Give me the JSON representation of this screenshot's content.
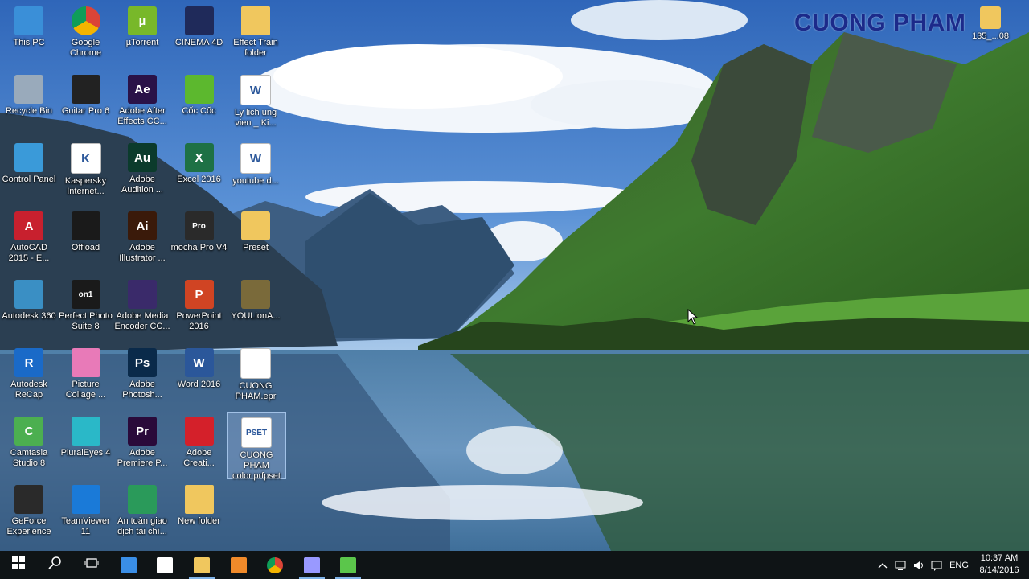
{
  "watermark": "CUONG PHAM",
  "desktop_icons": [
    {
      "label": "This PC",
      "icon": "monitor-icon",
      "color": "#3a8fd8",
      "glyph": "",
      "col": 0,
      "row": 0
    },
    {
      "label": "Google Chrome",
      "icon": "chrome-icon",
      "color": "#db4437",
      "glyph": "",
      "col": 1,
      "row": 0
    },
    {
      "label": "µTorrent",
      "icon": "utorrent-icon",
      "color": "#78b82a",
      "glyph": "µ",
      "col": 2,
      "row": 0
    },
    {
      "label": "CINEMA 4D",
      "icon": "cinema4d-icon",
      "color": "#1f2a5a",
      "glyph": "",
      "col": 3,
      "row": 0
    },
    {
      "label": "Effect Train folder",
      "icon": "folder-icon",
      "color": "#f0c75e",
      "glyph": "",
      "col": 4,
      "row": 0
    },
    {
      "label": "Recycle Bin",
      "icon": "recycle-bin-icon",
      "color": "#9ab",
      "glyph": "",
      "col": 0,
      "row": 1
    },
    {
      "label": "Guitar Pro 6",
      "icon": "guitar-pro-icon",
      "color": "#222",
      "glyph": "",
      "col": 1,
      "row": 1
    },
    {
      "label": "Adobe After Effects CC...",
      "icon": "after-effects-icon",
      "color": "#2a1248",
      "glyph": "Ae",
      "col": 2,
      "row": 1
    },
    {
      "label": "Cốc Cốc",
      "icon": "coccoc-icon",
      "color": "#5cb82e",
      "glyph": "",
      "col": 3,
      "row": 1
    },
    {
      "label": "Ly lich ung vien _ Ki...",
      "icon": "word-doc-icon",
      "color": "#ffffff",
      "glyph": "W",
      "col": 4,
      "row": 1
    },
    {
      "label": "Control Panel",
      "icon": "control-panel-icon",
      "color": "#3a9ad9",
      "glyph": "",
      "col": 0,
      "row": 2
    },
    {
      "label": "Kaspersky Internet...",
      "icon": "kaspersky-icon",
      "color": "#ffffff",
      "glyph": "K",
      "col": 1,
      "row": 2
    },
    {
      "label": "Adobe Audition ...",
      "icon": "audition-icon",
      "color": "#0b3b2c",
      "glyph": "Au",
      "col": 2,
      "row": 2
    },
    {
      "label": "Excel 2016",
      "icon": "excel-icon",
      "color": "#1e7145",
      "glyph": "X",
      "col": 3,
      "row": 2
    },
    {
      "label": "youtube.d...",
      "icon": "word-doc-icon",
      "color": "#ffffff",
      "glyph": "W",
      "col": 4,
      "row": 2
    },
    {
      "label": "AutoCAD 2015 - E...",
      "icon": "autocad-icon",
      "color": "#c8202e",
      "glyph": "A",
      "col": 0,
      "row": 3
    },
    {
      "label": "Offload",
      "icon": "offload-icon",
      "color": "#1a1a1a",
      "glyph": "",
      "col": 1,
      "row": 3
    },
    {
      "label": "Adobe Illustrator ...",
      "icon": "illustrator-icon",
      "color": "#3a1a0a",
      "glyph": "Ai",
      "col": 2,
      "row": 3
    },
    {
      "label": "mocha Pro V4",
      "icon": "mocha-icon",
      "color": "#2a2a2a",
      "glyph": "Pro",
      "col": 3,
      "row": 3
    },
    {
      "label": "Preset",
      "icon": "premiere-preset-icon",
      "color": "#f0c75e",
      "glyph": "",
      "col": 4,
      "row": 3
    },
    {
      "label": "Autodesk 360",
      "icon": "autodesk360-icon",
      "color": "#3a8fc4",
      "glyph": "",
      "col": 0,
      "row": 4
    },
    {
      "label": "Perfect Photo Suite 8",
      "icon": "perfect-photo-icon",
      "color": "#1a1a1a",
      "glyph": "on1",
      "col": 1,
      "row": 4
    },
    {
      "label": "Adobe Media Encoder CC...",
      "icon": "media-encoder-icon",
      "color": "#3a2a6a",
      "glyph": "",
      "col": 2,
      "row": 4
    },
    {
      "label": "PowerPoint 2016",
      "icon": "powerpoint-icon",
      "color": "#d04423",
      "glyph": "P",
      "col": 3,
      "row": 4
    },
    {
      "label": "YOULionA...",
      "icon": "image-file-icon",
      "color": "#7a6a3a",
      "glyph": "",
      "col": 4,
      "row": 4
    },
    {
      "label": "Autodesk ReCap",
      "icon": "recap-icon",
      "color": "#1a6ac8",
      "glyph": "R",
      "col": 0,
      "row": 5
    },
    {
      "label": "Picture Collage ...",
      "icon": "picture-collage-icon",
      "color": "#e87ab8",
      "glyph": "",
      "col": 1,
      "row": 5
    },
    {
      "label": "Adobe Photosh...",
      "icon": "photoshop-icon",
      "color": "#0a2a4a",
      "glyph": "Ps",
      "col": 2,
      "row": 5
    },
    {
      "label": "Word 2016",
      "icon": "word-icon",
      "color": "#2b579a",
      "glyph": "W",
      "col": 3,
      "row": 5
    },
    {
      "label": "CUONG PHAM.epr",
      "icon": "blank-file-icon",
      "color": "#ffffff",
      "glyph": "",
      "col": 4,
      "row": 5
    },
    {
      "label": "Camtasia Studio 8",
      "icon": "camtasia-icon",
      "color": "#4caf50",
      "glyph": "C",
      "col": 0,
      "row": 6
    },
    {
      "label": "PluralEyes 4",
      "icon": "pluraleyes-icon",
      "color": "#2ab8c8",
      "glyph": "",
      "col": 1,
      "row": 6
    },
    {
      "label": "Adobe Premiere P...",
      "icon": "premiere-icon",
      "color": "#2a0a3a",
      "glyph": "Pr",
      "col": 2,
      "row": 6
    },
    {
      "label": "Adobe Creati...",
      "icon": "creative-cloud-icon",
      "color": "#d4202a",
      "glyph": "",
      "col": 3,
      "row": 6
    },
    {
      "label": "CUONG PHAM color.prfpset",
      "icon": "prfpset-file-icon",
      "color": "#ffffff",
      "glyph": "PSET",
      "col": 4,
      "row": 6,
      "selected": true
    },
    {
      "label": "GeForce Experience",
      "icon": "geforce-icon",
      "color": "#2a2a2a",
      "glyph": "",
      "col": 0,
      "row": 7
    },
    {
      "label": "TeamViewer 11",
      "icon": "teamviewer-icon",
      "color": "#1a7ad8",
      "glyph": "",
      "col": 1,
      "row": 7
    },
    {
      "label": "An toàn giao dịch tài chí...",
      "icon": "kaspersky-safe-money-icon",
      "color": "#2a9a5a",
      "glyph": "",
      "col": 2,
      "row": 7
    },
    {
      "label": "New folder",
      "icon": "folder-icon",
      "color": "#f0c75e",
      "glyph": "",
      "col": 3,
      "row": 7
    }
  ],
  "top_right_folder": {
    "label": "135_...08",
    "icon": "folder-icon"
  },
  "taskbar": {
    "items": [
      {
        "name": "start-button",
        "icon": "windows-icon"
      },
      {
        "name": "search-button",
        "icon": "search-icon"
      },
      {
        "name": "task-view-button",
        "icon": "task-view-icon"
      },
      {
        "name": "edge-button",
        "icon": "edge-icon"
      },
      {
        "name": "store-button",
        "icon": "store-icon"
      },
      {
        "name": "file-explorer-button",
        "icon": "file-explorer-icon",
        "active": true
      },
      {
        "name": "media-player-button",
        "icon": "media-player-icon"
      },
      {
        "name": "chrome-button",
        "icon": "chrome-icon"
      },
      {
        "name": "premiere-button",
        "icon": "premiere-icon",
        "active": true
      },
      {
        "name": "camtasia-button",
        "icon": "camtasia-icon",
        "active": true
      }
    ],
    "language": "ENG",
    "time": "10:37 AM",
    "date": "8/14/2016"
  }
}
